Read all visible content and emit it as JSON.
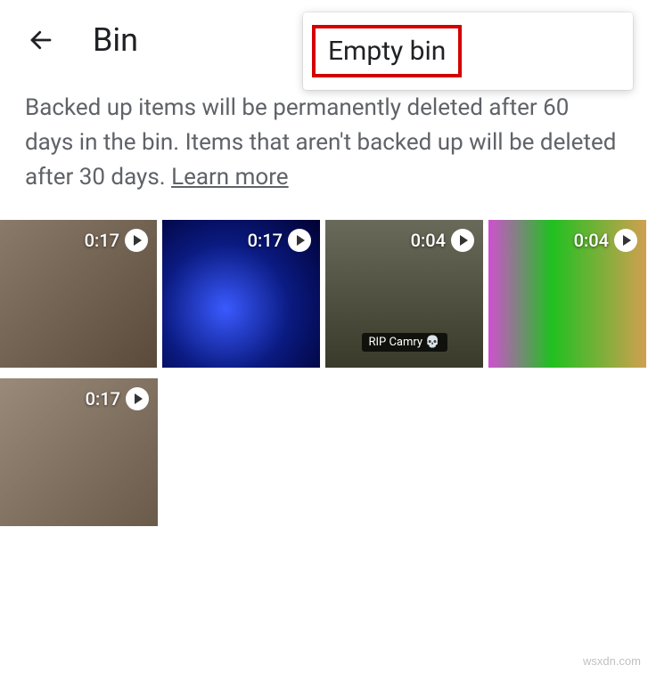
{
  "header": {
    "title": "Bin"
  },
  "menu": {
    "empty_bin": "Empty bin"
  },
  "info": {
    "text_part1": "Backed up items will be permanently deleted after 60 days in the bin. Items that aren't backed up will be deleted after 30 days. ",
    "learn_more": "Learn more"
  },
  "thumbnails": [
    {
      "duration": "0:17",
      "caption": ""
    },
    {
      "duration": "0:17",
      "caption": ""
    },
    {
      "duration": "0:04",
      "caption": "RIP Camry 💀"
    },
    {
      "duration": "0:04",
      "caption": ""
    },
    {
      "duration": "0:17",
      "caption": ""
    }
  ],
  "watermark": "wsxdn.com"
}
